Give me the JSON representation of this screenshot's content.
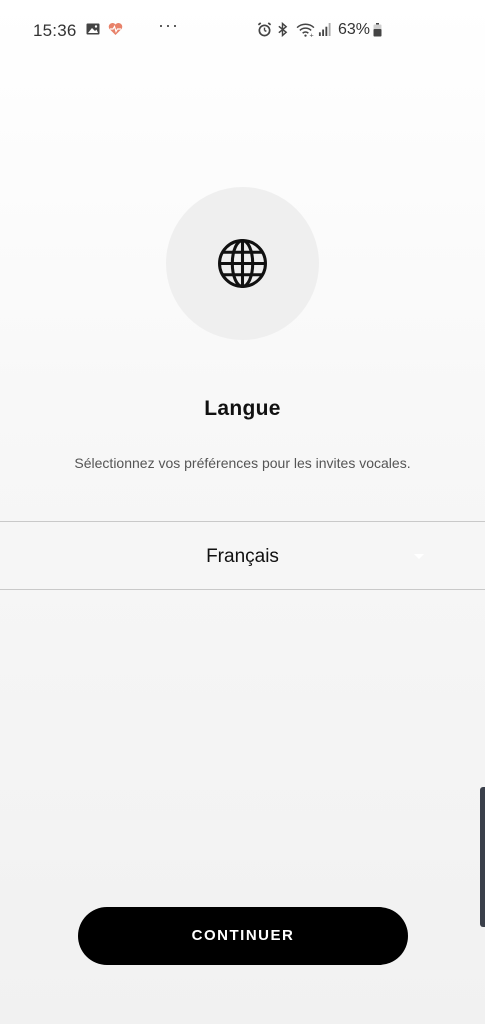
{
  "status_bar": {
    "time": "15:36",
    "more_indicator": "···",
    "battery_percent": "63%",
    "icons": [
      "gallery-icon",
      "heart-rate-icon",
      "alarm-icon",
      "bluetooth-icon",
      "wifi-icon",
      "signal-icon",
      "battery-icon"
    ]
  },
  "screen": {
    "icon": "globe-icon",
    "title": "Langue",
    "subtitle": "Sélectionnez vos préférences pour les invites vocales."
  },
  "language_select": {
    "selected": "Français"
  },
  "actions": {
    "continue_label": "CONTINUER"
  },
  "colors": {
    "button_background": "#000000",
    "button_text": "#ffffff",
    "icon_circle": "#efefef",
    "heart_icon": "#e8826a"
  }
}
